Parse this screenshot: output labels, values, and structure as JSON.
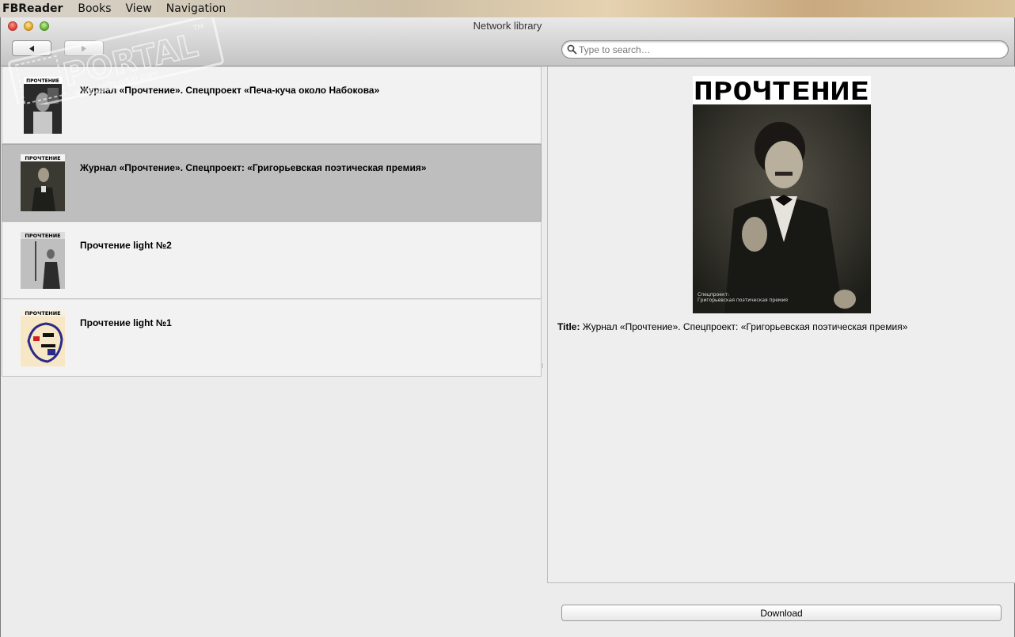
{
  "menubar": {
    "app_name": "FBReader",
    "items": [
      "Books",
      "View",
      "Navigation"
    ]
  },
  "window": {
    "title": "Network library"
  },
  "toolbar": {
    "back_icon": "left-arrow-icon",
    "forward_icon": "right-arrow-icon",
    "search_placeholder": "Type to search…",
    "search_value": ""
  },
  "books": [
    {
      "title": "Журнал «Прочтение». Спецпроект «Печа-куча около Набокова»",
      "selected": false
    },
    {
      "title": "Журнал «Прочтение». Спецпроект: «Григорьевская поэтическая премия»",
      "selected": true
    },
    {
      "title": "Прочтение light №2",
      "selected": false
    },
    {
      "title": "Прочтение light №1",
      "selected": false
    }
  ],
  "thumb_logo_text": "ПРОЧТЕНИЕ",
  "details": {
    "cover_logo": "ПРОЧТЕНИЕ",
    "cover_caption_line1": "Спецпроект:",
    "cover_caption_line2": "Григорьевская поэтическая премия",
    "title_label": "Title:",
    "title_value": "Журнал «Прочтение». Спецпроект: «Григорьевская поэтическая премия»"
  },
  "actions": {
    "download_label": "Download"
  },
  "watermark": {
    "text": "PORTAL",
    "tm": "TM",
    "url": "www.softportal.com"
  },
  "colors": {
    "selected_row": "#bebebe",
    "row_bg": "#f2f2f2",
    "window_bg": "#ececec"
  }
}
